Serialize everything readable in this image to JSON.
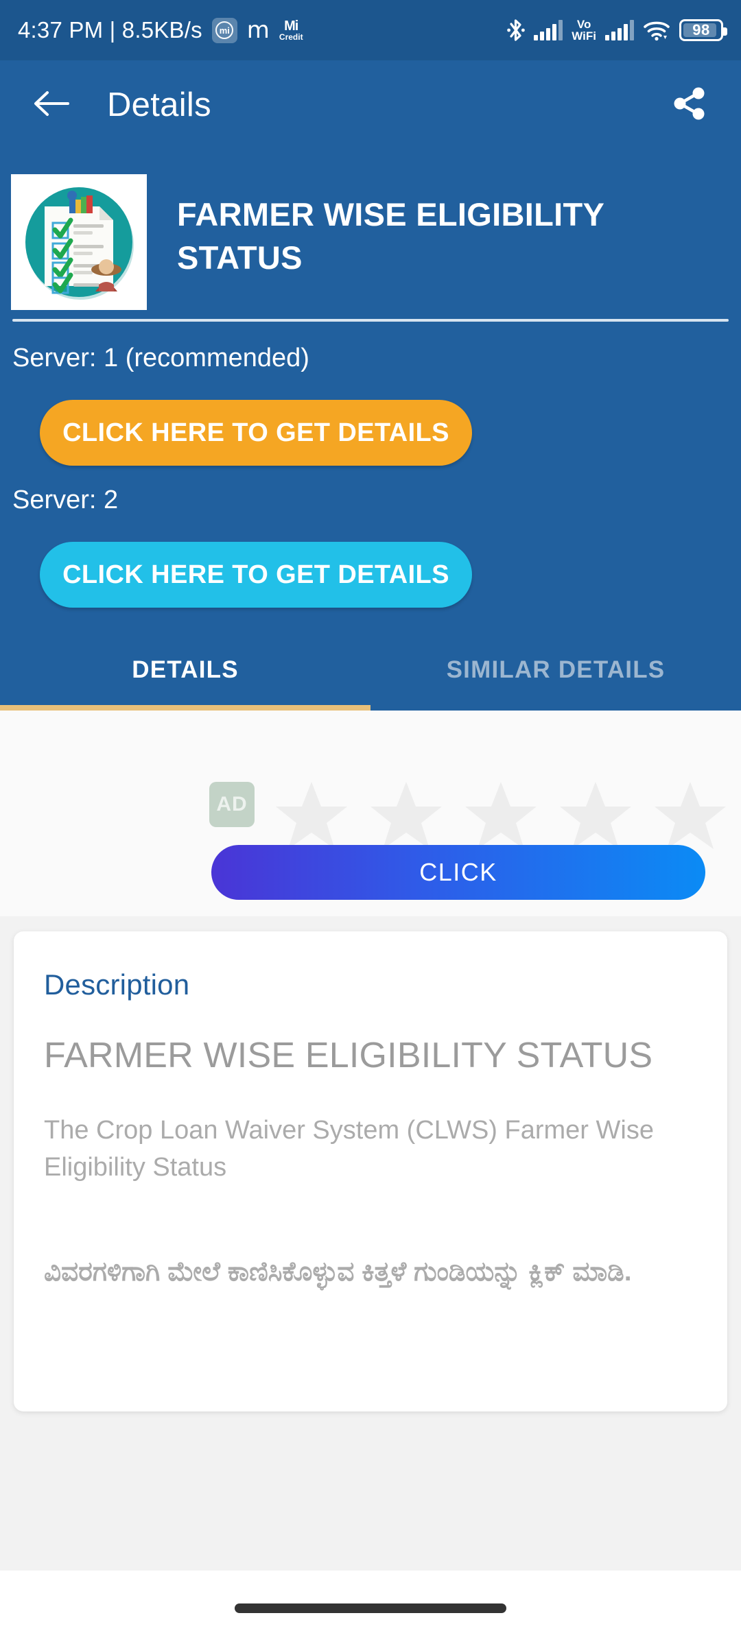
{
  "status_bar": {
    "clock": "4:37 PM | 8.5KB/s",
    "mi_badge_letter": "mi",
    "m_glyph": "m",
    "micredit_top": "Mi",
    "micredit_bottom": "Credit",
    "vowifi_top": "Vo",
    "vowifi_bottom": "WiFi",
    "battery_level": "98",
    "icons": [
      "mi-icon",
      "m-icon",
      "mi-credit-icon",
      "bluetooth-icon",
      "signal-bars-icon",
      "vowifi-icon",
      "signal-bars-2-icon",
      "wifi-icon",
      "battery-icon"
    ]
  },
  "app_bar": {
    "title": "Details",
    "back_icon": "arrow-left-icon",
    "share_icon": "share-icon"
  },
  "hero": {
    "app_title": "FARMER WISE ELIGIBILITY STATUS",
    "app_icon_name": "checklist-clipboard-icon",
    "servers": [
      {
        "label": "Server: 1 (recommended)",
        "button_label": "CLICK HERE TO GET DETAILS",
        "color": "#F5A623"
      },
      {
        "label": "Server: 2",
        "button_label": "CLICK HERE TO GET DETAILS",
        "color": "#22C0E8"
      }
    ]
  },
  "tabs": [
    {
      "label": "DETAILS",
      "active": true
    },
    {
      "label": "SIMILAR DETAILS",
      "active": false
    }
  ],
  "ad": {
    "badge_label": "AD",
    "star_count": 5,
    "click_button_label": "CLICK"
  },
  "description": {
    "heading": "Description",
    "title": "FARMER WISE ELIGIBILITY STATUS",
    "body": "The Crop Loan Waiver System (CLWS) Farmer Wise Eligibility Status",
    "kannada": "ವಿವರಗಳಿಗಾಗಿ ಮೇಲೆ ಕಾಣಿಸಿಕೊಳ್ಳುವ ಕಿತ್ತಳೆ ಗುಂಡಿಯನ್ನು ಕ್ಲಿಕ್ ಮಾಡಿ."
  },
  "nav_bar": {
    "gesture_pill": "home-gesture-pill"
  },
  "colors": {
    "status_bar_blue": "#1C568E",
    "header_blue": "#21609E",
    "server1_orange": "#F5A623",
    "server2_cyan": "#22C0E8",
    "tab_indicator": "#E8C07A",
    "description_heading_blue": "#215E9C",
    "content_bg": "#F2F2F2"
  }
}
